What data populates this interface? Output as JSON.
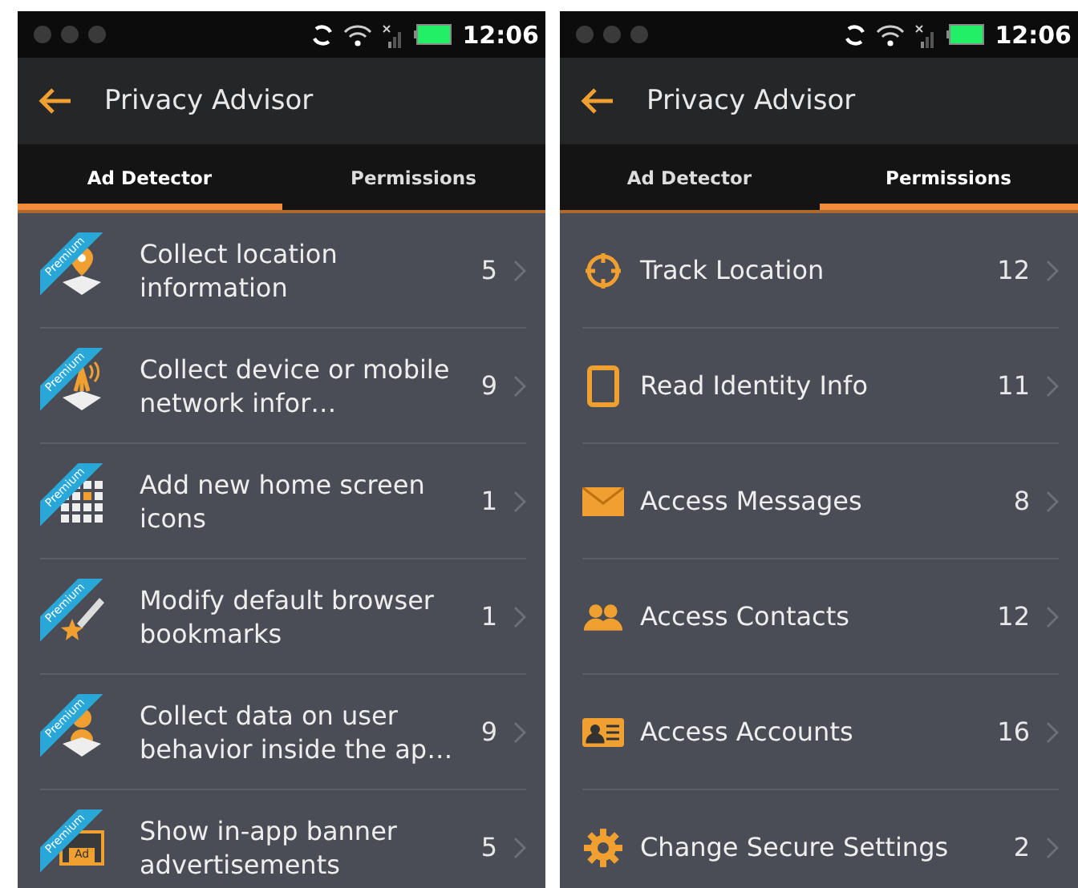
{
  "screens": [
    {
      "status_bar": {
        "time": "12:06"
      },
      "app_bar": {
        "title": "Privacy Advisor"
      },
      "tabs": [
        {
          "label": "Ad Detector",
          "selected": true
        },
        {
          "label": "Permissions",
          "selected": false
        }
      ],
      "items": [
        {
          "kind": "premium",
          "ribbon": "Premium",
          "label": "Collect location information",
          "count": "5"
        },
        {
          "kind": "premium",
          "ribbon": "Premium",
          "label": "Collect device or mobile network infor…",
          "count": "9"
        },
        {
          "kind": "premium",
          "ribbon": "Premium",
          "label": "Add new home screen icons",
          "count": "1"
        },
        {
          "kind": "premium",
          "ribbon": "Premium",
          "label": "Modify default browser bookmarks",
          "count": "1"
        },
        {
          "kind": "premium",
          "ribbon": "Premium",
          "label": "Collect data on user behavior inside the ap…",
          "count": "9"
        },
        {
          "kind": "premium",
          "ribbon": "Premium",
          "icon_text": "Ad",
          "label": "Show in-app banner advertisements",
          "count": "5"
        }
      ]
    },
    {
      "status_bar": {
        "time": "12:06"
      },
      "app_bar": {
        "title": "Privacy Advisor"
      },
      "tabs": [
        {
          "label": "Ad Detector",
          "selected": false
        },
        {
          "label": "Permissions",
          "selected": true
        }
      ],
      "items": [
        {
          "kind": "plain",
          "label": "Track Location",
          "count": "12"
        },
        {
          "kind": "plain",
          "label": "Read Identity Info",
          "count": "11"
        },
        {
          "kind": "plain",
          "label": "Access Messages",
          "count": "8"
        },
        {
          "kind": "plain",
          "label": "Access Contacts",
          "count": "12"
        },
        {
          "kind": "plain",
          "label": "Access Accounts",
          "count": "16"
        },
        {
          "kind": "plain",
          "label": "Change Secure Settings",
          "count": "2"
        }
      ]
    }
  ]
}
